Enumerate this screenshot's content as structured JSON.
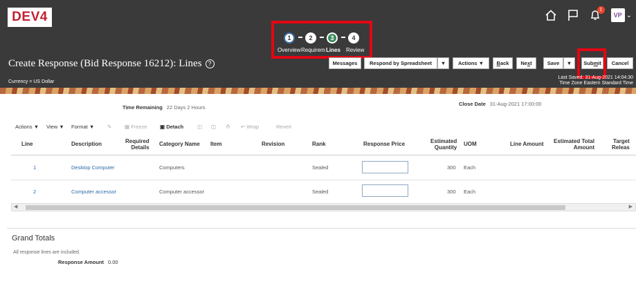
{
  "header": {
    "logo": "DEV4",
    "notification_count": "1",
    "avatar_initials": "VP",
    "page_title": "Create Response (Bid Response 16212): Lines",
    "currency": "Currency = US Dollar",
    "last_saved": "Last Saved: 31-Aug-2021 14:04:30",
    "time_zone": "Time Zone Eastern Standard Time"
  },
  "train": {
    "stops": [
      {
        "number": "1",
        "label": "Overview"
      },
      {
        "number": "2",
        "label": "Requirem"
      },
      {
        "number": "3",
        "label": "Lines"
      },
      {
        "number": "4",
        "label": "Review"
      }
    ]
  },
  "toolbar": {
    "messages": "Messages",
    "respond_by_spreadsheet": "Respond by Spreadsheet",
    "actions": "Actions",
    "back_prefix": "",
    "back_u": "B",
    "back_suffix": "ack",
    "next_prefix": "Ne",
    "next_u": "x",
    "next_suffix": "t",
    "save": "Save",
    "submit_prefix": "Sub",
    "submit_u": "m",
    "submit_suffix": "it",
    "cancel": "Cancel"
  },
  "summary": {
    "time_remaining_label": "Time Remaining",
    "time_remaining_value": "22 Days 2 Hours",
    "close_date_label": "Close Date",
    "close_date_value": "31-Aug-2021 17:00:00"
  },
  "table_toolbar": {
    "actions": "Actions",
    "view": "View",
    "format": "Format",
    "freeze": "Freeze",
    "detach": "Detach",
    "wrap": "Wrap",
    "revert": "Revert"
  },
  "table": {
    "columns": {
      "line": "Line",
      "description": "Description",
      "required_details_1": "Required",
      "required_details_2": "Details",
      "category_name": "Category Name",
      "item": "Item",
      "revision": "Revision",
      "rank": "Rank",
      "response_price": "Response Price",
      "estimated_quantity_1": "Estimated",
      "estimated_quantity_2": "Quantity",
      "uom": "UOM",
      "line_amount": "Line Amount",
      "estimated_total_amount_1": "Estimated Total",
      "estimated_total_amount_2": "Amount",
      "target_release_1": "Target",
      "target_release_2": "Releas"
    },
    "rows": [
      {
        "line": "1",
        "description": "Desktop Computer",
        "category": "Computers",
        "rank": "Sealed",
        "quantity": "300",
        "uom": "Each"
      },
      {
        "line": "2",
        "description": "Computer accessor",
        "category": "Computer accessor",
        "rank": "Sealed",
        "quantity": "300",
        "uom": "Each"
      }
    ]
  },
  "grand_totals": {
    "title": "Grand Totals",
    "note": "All response lines are included.",
    "response_amount_label": "Response Amount",
    "response_amount_value": "0.00"
  },
  "icons": {
    "home": "home-icon",
    "flag": "flag-icon",
    "bell": "bell-icon",
    "help": "help-icon",
    "pencil": "pencil-icon",
    "freeze": "freeze-icon",
    "detach": "detach-icon",
    "wrap": "wrap-icon"
  },
  "colors": {
    "header_bg": "#3a3a3a",
    "highlight": "#e30613",
    "current_step": "#3a8a5c",
    "link": "#2a6aa7"
  }
}
